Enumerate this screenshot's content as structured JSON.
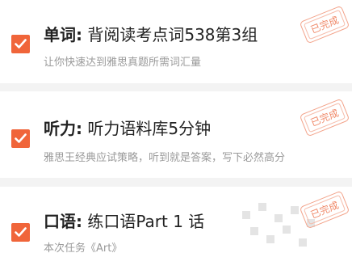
{
  "tasks": [
    {
      "category": "单词:",
      "title": "背阅读考点词538第3组",
      "description": "让你快速达到雅思真题所需词汇量",
      "status": "已完成",
      "checked": true
    },
    {
      "category": "听力:",
      "title": "听力语料库5分钟",
      "description": "雅思王经典应试策略，听到就是答案，写下必然高分",
      "status": "已完成",
      "checked": true
    },
    {
      "category": "口语:",
      "title": "练口语Part 1 话",
      "description": "本次任务《Art》",
      "status": "已完成",
      "checked": true
    }
  ],
  "colors": {
    "accent": "#f0653a",
    "stamp": "#f08a6a",
    "background": "#f3f3f3"
  },
  "icons": {
    "checkbox": "check-icon"
  }
}
